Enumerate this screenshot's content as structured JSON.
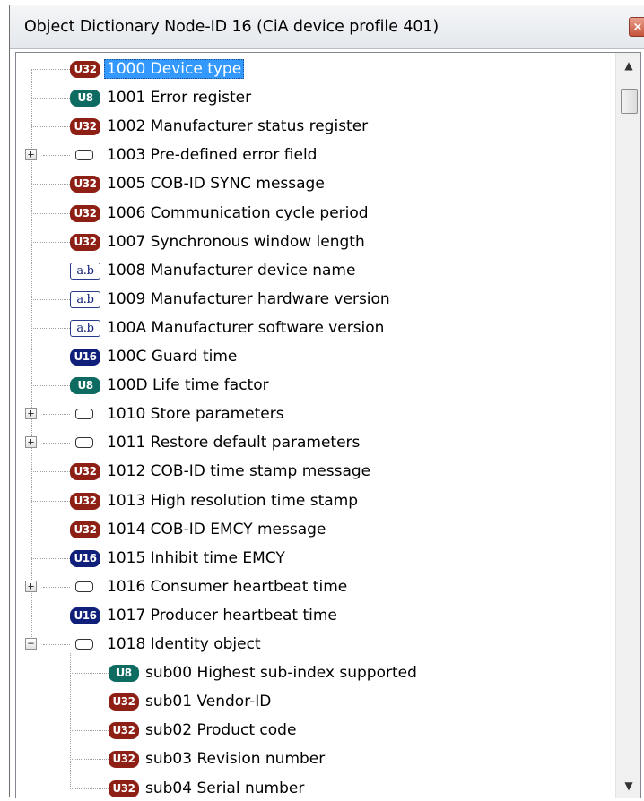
{
  "window": {
    "title": "Object Dictionary  Node-ID 16  (CiA device profile 401)",
    "close_label": "×"
  },
  "tree": {
    "entries": [
      {
        "badge": "U32",
        "type": "u32",
        "label": "1000  Device type",
        "selected": true
      },
      {
        "badge": "U8",
        "type": "u8",
        "label": "1001  Error register"
      },
      {
        "badge": "U32",
        "type": "u32",
        "label": "1002  Manufacturer status register"
      },
      {
        "badge": "",
        "type": "rec",
        "label": "1003  Pre-defined error field",
        "expander": "+"
      },
      {
        "badge": "U32",
        "type": "u32",
        "label": "1005  COB-ID SYNC message"
      },
      {
        "badge": "U32",
        "type": "u32",
        "label": "1006  Communication cycle period"
      },
      {
        "badge": "U32",
        "type": "u32",
        "label": "1007  Synchronous window length"
      },
      {
        "badge": "a.b",
        "type": "str",
        "label": "1008  Manufacturer device name"
      },
      {
        "badge": "a.b",
        "type": "str",
        "label": "1009  Manufacturer hardware version"
      },
      {
        "badge": "a.b",
        "type": "str",
        "label": "100A  Manufacturer software version"
      },
      {
        "badge": "U16",
        "type": "u16",
        "label": "100C  Guard time"
      },
      {
        "badge": "U8",
        "type": "u8",
        "label": "100D  Life time factor"
      },
      {
        "badge": "",
        "type": "rec",
        "label": "1010  Store parameters",
        "expander": "+"
      },
      {
        "badge": "",
        "type": "rec",
        "label": "1011  Restore default parameters",
        "expander": "+"
      },
      {
        "badge": "U32",
        "type": "u32",
        "label": "1012  COB-ID time stamp message"
      },
      {
        "badge": "U32",
        "type": "u32",
        "label": "1013  High resolution time stamp"
      },
      {
        "badge": "U32",
        "type": "u32",
        "label": "1014  COB-ID EMCY message"
      },
      {
        "badge": "U16",
        "type": "u16",
        "label": "1015  Inhibit time EMCY"
      },
      {
        "badge": "",
        "type": "rec",
        "label": "1016  Consumer heartbeat time",
        "expander": "+"
      },
      {
        "badge": "U16",
        "type": "u16",
        "label": "1017  Producer heartbeat time"
      },
      {
        "badge": "",
        "type": "rec",
        "label": "1018  Identity object",
        "expander": "−"
      },
      {
        "badge": "U8",
        "type": "u8",
        "label": "sub00  Highest sub-index supported",
        "child": true
      },
      {
        "badge": "U32",
        "type": "u32",
        "label": "sub01  Vendor-ID",
        "child": true
      },
      {
        "badge": "U32",
        "type": "u32",
        "label": "sub02  Product code",
        "child": true
      },
      {
        "badge": "U32",
        "type": "u32",
        "label": "sub03  Revision number",
        "child": true
      },
      {
        "badge": "U32",
        "type": "u32",
        "label": "sub04  Serial number",
        "child": true
      }
    ]
  },
  "scrollbar": {
    "up_arrow": "▲",
    "down_arrow": "▼"
  },
  "colors": {
    "u32_badge": "#8d1f15",
    "u8_badge": "#0e6b62",
    "u16_badge": "#0f1f7a",
    "selection": "#3399ff"
  }
}
